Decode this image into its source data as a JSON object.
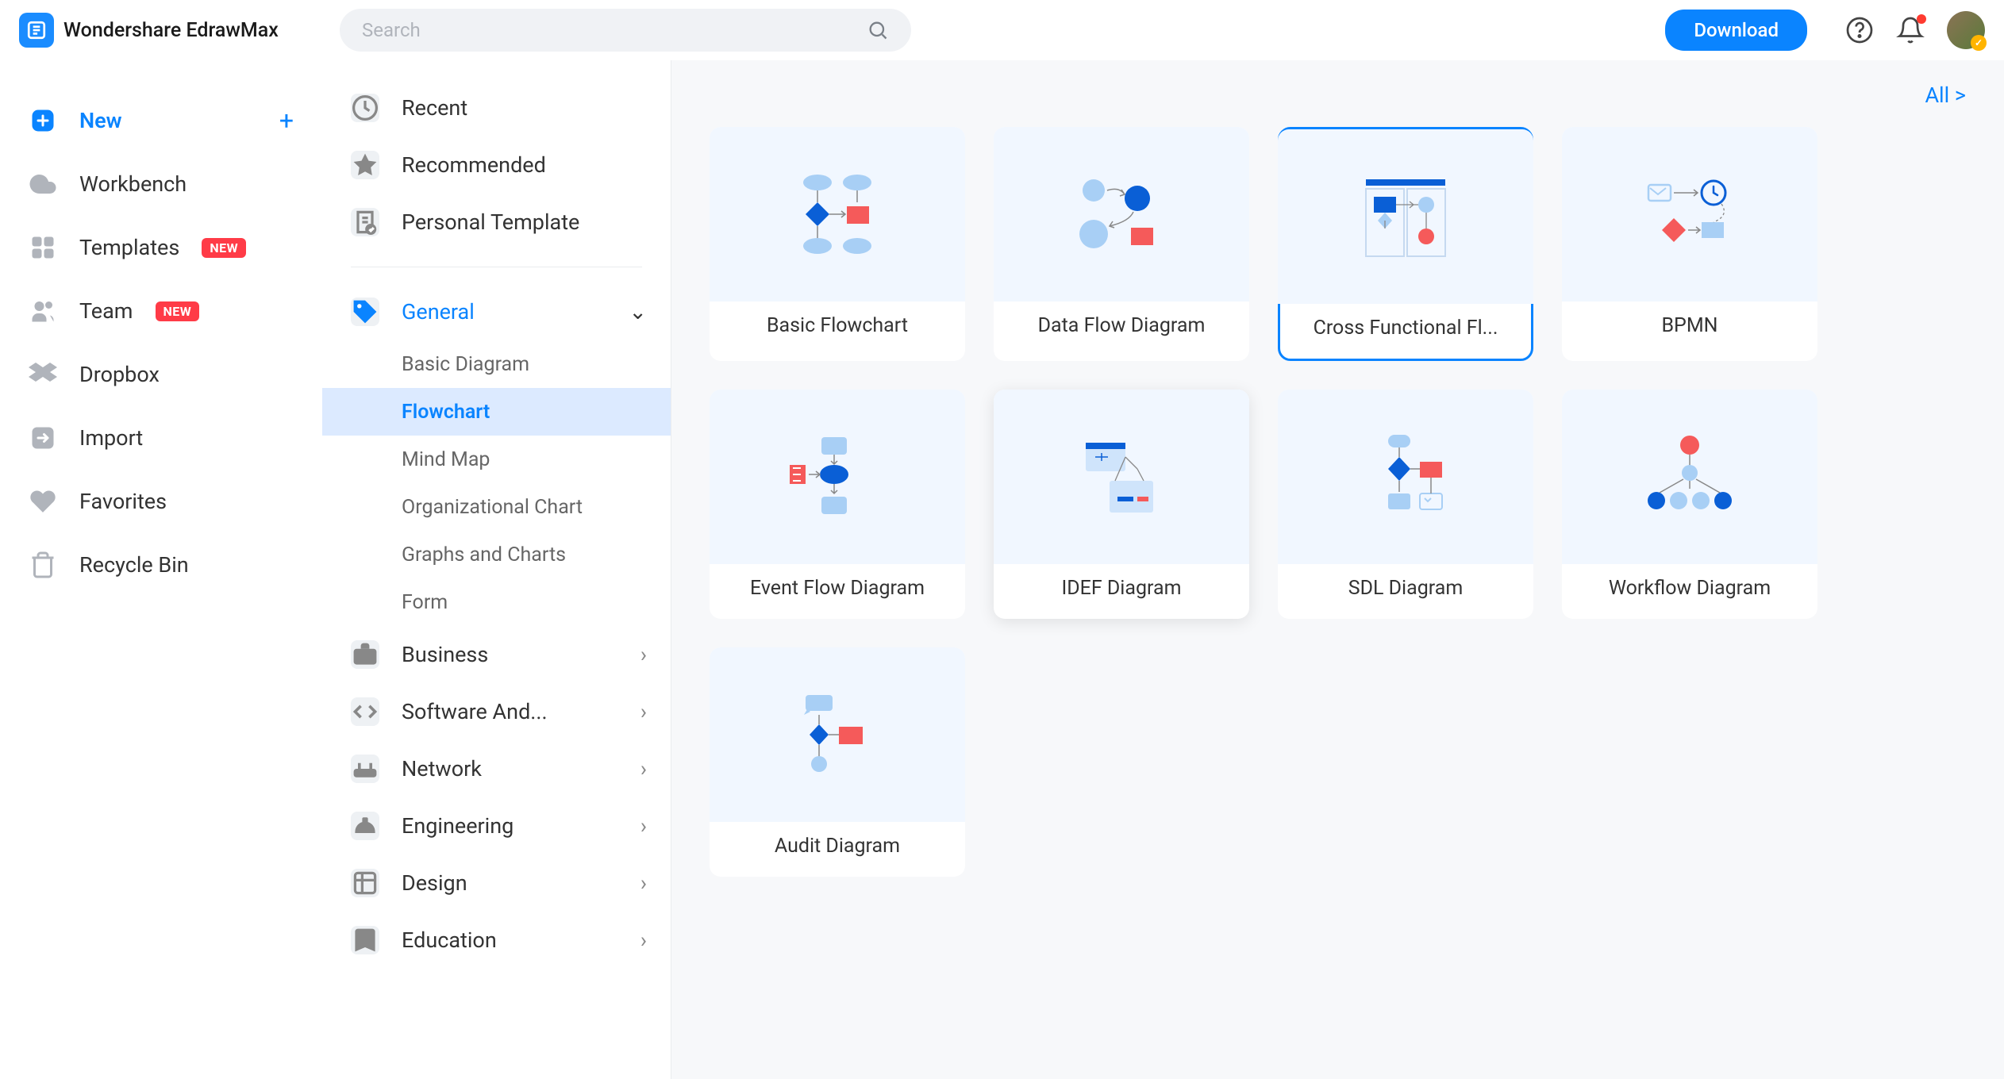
{
  "app_name": "Wondershare EdrawMax",
  "search": {
    "placeholder": "Search"
  },
  "download_label": "Download",
  "sidebar": {
    "items": [
      {
        "label": "New",
        "icon": "plus-square",
        "active": true,
        "trailing_plus": true
      },
      {
        "label": "Workbench",
        "icon": "cloud"
      },
      {
        "label": "Templates",
        "icon": "template",
        "badge": "NEW"
      },
      {
        "label": "Team",
        "icon": "team",
        "badge": "NEW"
      },
      {
        "label": "Dropbox",
        "icon": "dropbox"
      },
      {
        "label": "Import",
        "icon": "import"
      },
      {
        "label": "Favorites",
        "icon": "heart"
      },
      {
        "label": "Recycle Bin",
        "icon": "trash"
      }
    ]
  },
  "mid": {
    "top": [
      {
        "label": "Recent",
        "icon": "clock"
      },
      {
        "label": "Recommended",
        "icon": "star"
      },
      {
        "label": "Personal Template",
        "icon": "doc-check"
      }
    ],
    "categories": [
      {
        "label": "General",
        "icon": "tag",
        "expanded": true,
        "subs": [
          {
            "label": "Basic Diagram"
          },
          {
            "label": "Flowchart",
            "selected": true
          },
          {
            "label": "Mind Map"
          },
          {
            "label": "Organizational Chart"
          },
          {
            "label": "Graphs and Charts"
          },
          {
            "label": "Form"
          }
        ]
      },
      {
        "label": "Business",
        "icon": "briefcase"
      },
      {
        "label": "Software And...",
        "icon": "code"
      },
      {
        "label": "Network",
        "icon": "router"
      },
      {
        "label": "Engineering",
        "icon": "hardhat"
      },
      {
        "label": "Design",
        "icon": "design"
      },
      {
        "label": "Education",
        "icon": "book"
      }
    ]
  },
  "content": {
    "all_label": "All  >",
    "cards": [
      {
        "label": "Basic Flowchart"
      },
      {
        "label": "Data Flow Diagram"
      },
      {
        "label": "Cross Functional Fl...",
        "selected": true
      },
      {
        "label": "BPMN"
      },
      {
        "label": "Event Flow Diagram"
      },
      {
        "label": "IDEF Diagram",
        "hover": true
      },
      {
        "label": "SDL Diagram"
      },
      {
        "label": "Workflow Diagram"
      },
      {
        "label": "Audit Diagram"
      }
    ]
  }
}
